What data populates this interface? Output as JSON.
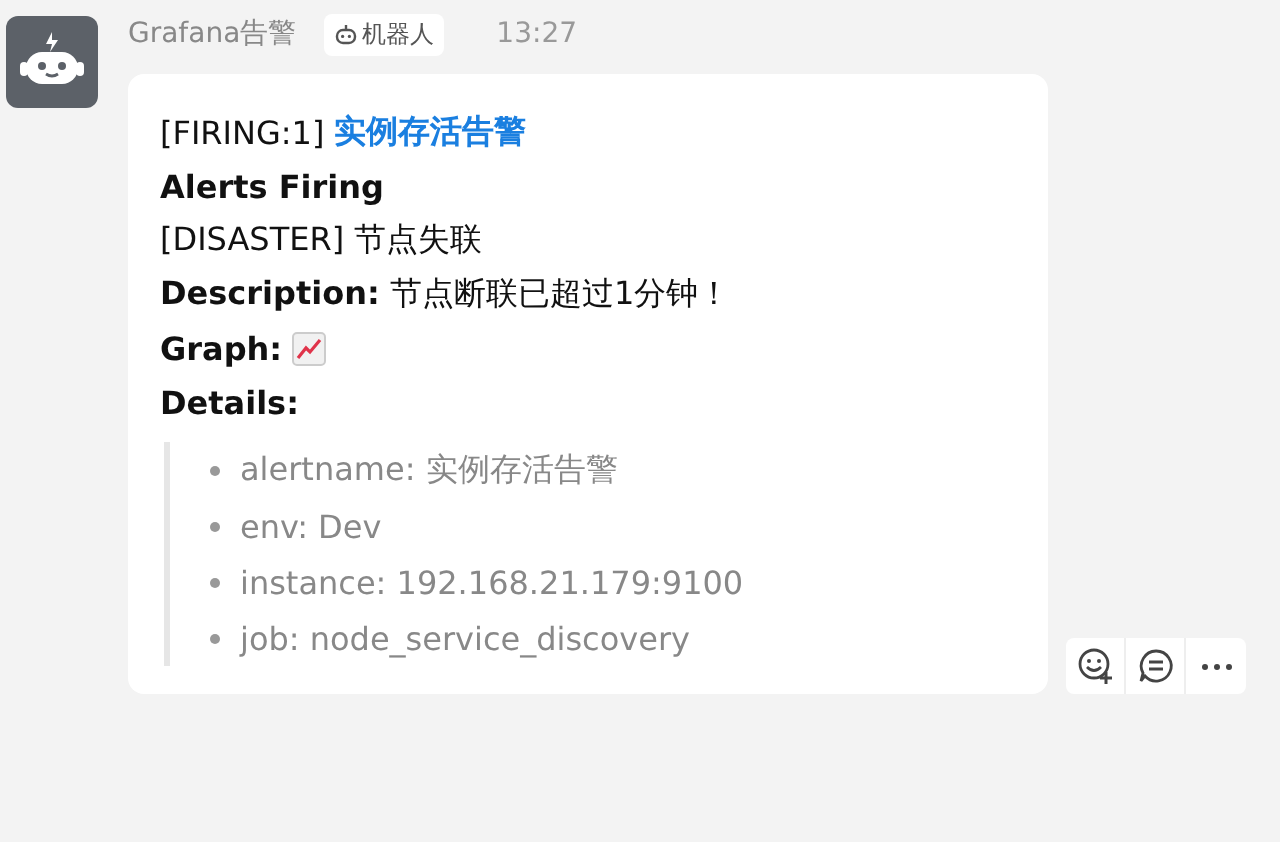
{
  "message": {
    "sender": "Grafana告警",
    "badge": "机器人",
    "time": "13:27"
  },
  "card": {
    "title_prefix": "[FIRING:1]",
    "title_link": "实例存活告警",
    "heading": "Alerts Firing",
    "severity_line": "[DISASTER] 节点失联",
    "description": "**Description:** 节点断联已超过1分钟！",
    "graph_label": "Graph:",
    "details_label": "Details:",
    "details": [
      "alertname: 实例存活告警",
      "env: Dev",
      "instance: 192.168.21.179:9100",
      "job: node_service_discovery"
    ]
  },
  "actions": [
    {
      "kind": "emoji"
    },
    {
      "kind": "reply"
    },
    {
      "kind": "more"
    }
  ]
}
